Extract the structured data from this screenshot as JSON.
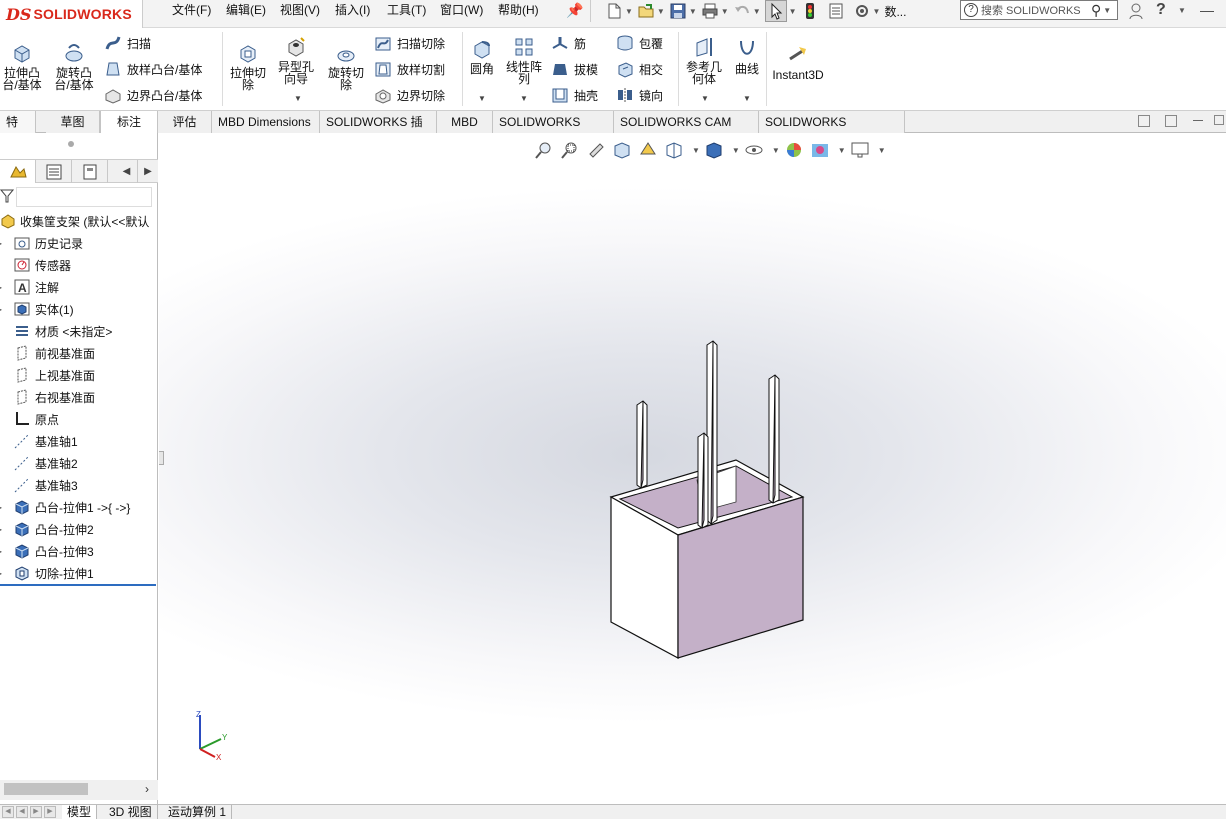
{
  "app": {
    "logo_ds": "DS",
    "logo_text": "SOLIDWORKS"
  },
  "menu": [
    "文件(F)",
    "编辑(E)",
    "视图(V)",
    "插入(I)",
    "工具(T)",
    "窗口(W)",
    "帮助(H)"
  ],
  "quick_access": {
    "truncated_label": "数...",
    "search_placeholder": "搜索 SOLIDWORKS"
  },
  "ribbon": {
    "extrude_boss": [
      "拉伸凸",
      "台/基体"
    ],
    "revolve_boss": [
      "旋转凸",
      "台/基体"
    ],
    "sweep": "扫描",
    "loft": "放样凸台/基体",
    "boundary_boss": "边界凸台/基体",
    "extrude_cut": [
      "拉伸切",
      "除"
    ],
    "hole_wizard": [
      "异型孔",
      "向导"
    ],
    "revolve_cut": [
      "旋转切",
      "除"
    ],
    "swept_cut": "扫描切除",
    "lofted_cut": "放样切割",
    "boundary_cut": "边界切除",
    "fillet": "圆角",
    "linear_pattern": [
      "线性阵",
      "列"
    ],
    "rib": "筋",
    "draft": "拔模",
    "shell": "抽壳",
    "wrap": "包覆",
    "intersect": "相交",
    "mirror": "镜向",
    "ref_geometry": [
      "参考几",
      "何体"
    ],
    "curves": "曲线",
    "instant3d": "Instant3D"
  },
  "command_tabs": [
    "特征",
    "草图",
    "标注",
    "评估",
    "MBD Dimensions",
    "SOLIDWORKS 插件",
    "MBD",
    "SOLIDWORKS CAM",
    "SOLIDWORKS CAM TBM",
    "SOLIDWORKS Inspection"
  ],
  "active_command_tab": "标注",
  "tree": {
    "root": "收集筐支架 (默认<<默认",
    "items": [
      {
        "label": "历史记录",
        "icon": "history-icon",
        "expandable": true
      },
      {
        "label": "传感器",
        "icon": "sensor-icon",
        "expandable": false
      },
      {
        "label": "注解",
        "icon": "annotation-icon",
        "expandable": true
      },
      {
        "label": "实体(1)",
        "icon": "solid-body-icon",
        "expandable": true
      },
      {
        "label": "材质 <未指定>",
        "icon": "material-icon",
        "expandable": false
      },
      {
        "label": "前视基准面",
        "icon": "plane-icon",
        "expandable": false
      },
      {
        "label": "上视基准面",
        "icon": "plane-icon",
        "expandable": false
      },
      {
        "label": "右视基准面",
        "icon": "plane-icon",
        "expandable": false
      },
      {
        "label": "原点",
        "icon": "origin-icon",
        "expandable": false
      },
      {
        "label": "基准轴1",
        "icon": "axis-icon",
        "expandable": false
      },
      {
        "label": "基准轴2",
        "icon": "axis-icon",
        "expandable": false
      },
      {
        "label": "基准轴3",
        "icon": "axis-icon",
        "expandable": false
      },
      {
        "label": "凸台-拉伸1 ->{ ->}",
        "icon": "extrude-feature-icon",
        "expandable": true
      },
      {
        "label": "凸台-拉伸2",
        "icon": "extrude-feature-icon",
        "expandable": true
      },
      {
        "label": "凸台-拉伸3",
        "icon": "extrude-feature-icon",
        "expandable": true
      },
      {
        "label": "切除-拉伸1",
        "icon": "cut-feature-icon",
        "expandable": true
      }
    ]
  },
  "triad": {
    "z": "Z",
    "y": "Y",
    "x": "X"
  },
  "bottom_tabs": [
    "模型",
    "3D 视图",
    "运动算例 1"
  ],
  "active_bottom_tab": "模型",
  "colors": {
    "accent": "#d9281b",
    "face_purple": "#c4b0c8",
    "selection_blue": "#2d6cc0"
  }
}
